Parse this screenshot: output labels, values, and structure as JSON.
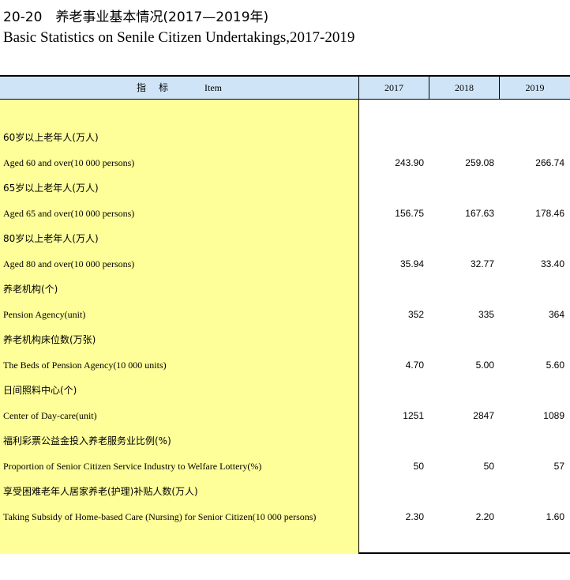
{
  "title": {
    "cn": "20-20　养老事业基本情况(2017—2019年)",
    "en": "Basic Statistics on Senile Citizen Undertakings,2017-2019"
  },
  "header": {
    "item_cn": "指　标",
    "item_en": "Item",
    "years": [
      "2017",
      "2018",
      "2019"
    ]
  },
  "rows": [
    {
      "cn": "60岁以上老年人(万人)",
      "en": "Aged 60 and over(10 000 persons)",
      "values": [
        "243.90",
        "259.08",
        "266.74"
      ]
    },
    {
      "cn": "65岁以上老年人(万人)",
      "en": "Aged 65 and over(10 000 persons)",
      "values": [
        "156.75",
        "167.63",
        "178.46"
      ]
    },
    {
      "cn": "80岁以上老年人(万人)",
      "en": "Aged 80 and over(10 000 persons)",
      "values": [
        "35.94",
        "32.77",
        "33.40"
      ]
    },
    {
      "cn": "养老机构(个)",
      "en": "Pension Agency(unit)",
      "values": [
        "352",
        "335",
        "364"
      ]
    },
    {
      "cn": "养老机构床位数(万张)",
      "en": "The Beds of Pension Agency(10 000 units)",
      "values": [
        "4.70",
        "5.00",
        "5.60"
      ]
    },
    {
      "cn": "日间照料中心(个)",
      "en": "Center of Day-care(unit)",
      "values": [
        "1251",
        "2847",
        "1089"
      ]
    },
    {
      "cn": "福利彩票公益金投入养老服务业比例(%)",
      "en": "Proportion of Senior Citizen Service Industry to Welfare Lottery(%)",
      "values": [
        "50",
        "50",
        "57"
      ]
    },
    {
      "cn": "享受困难老年人居家养老(护理)补贴人数(万人)",
      "en": "Taking Subsidy of Home-based Care (Nursing) for Senior Citizen(10 000 persons)",
      "values": [
        "2.30",
        "2.20",
        "1.60"
      ]
    }
  ],
  "colors": {
    "header_bg": "#cfe5f7",
    "indicator_bg": "#ffff99"
  }
}
